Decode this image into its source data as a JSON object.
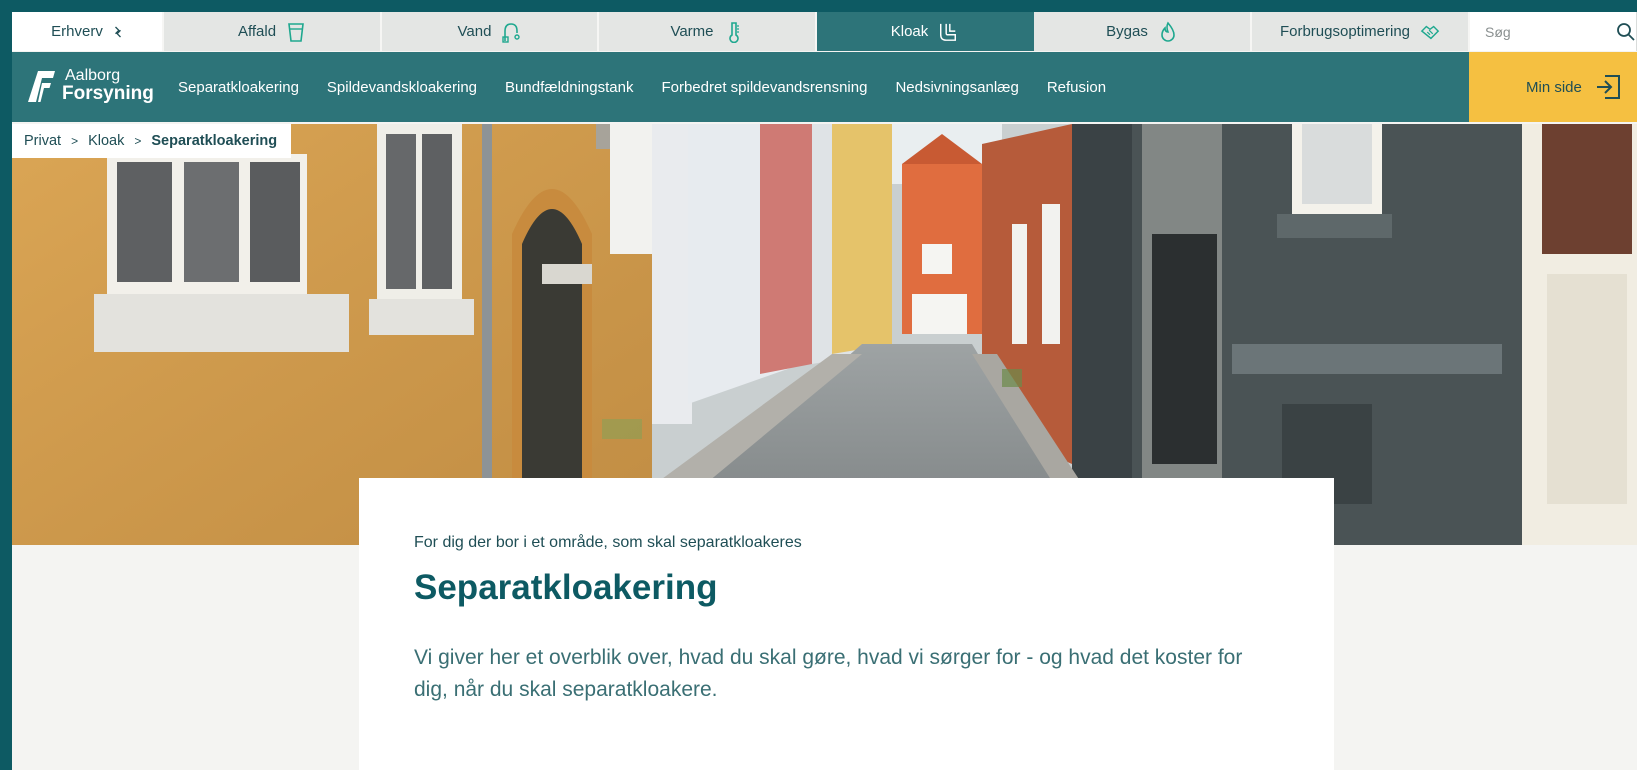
{
  "utility_tabs": [
    {
      "label": "Erhverv",
      "icon": "swap-arrows-icon"
    },
    {
      "label": "Affald",
      "icon": "bin-icon"
    },
    {
      "label": "Vand",
      "icon": "tap-icon"
    },
    {
      "label": "Varme",
      "icon": "thermometer-icon"
    },
    {
      "label": "Kloak",
      "icon": "pipes-icon",
      "active": true
    },
    {
      "label": "Bygas",
      "icon": "flame-icon"
    },
    {
      "label": "Forbrugsoptimering",
      "icon": "handshake-icon"
    }
  ],
  "search": {
    "placeholder": "Søg",
    "icon": "search-icon"
  },
  "logo": {
    "line1": "Aalborg",
    "line2": "Forsyning"
  },
  "nav": {
    "items": [
      "Separatkloakering",
      "Spildevandskloakering",
      "Bundfældningstank",
      "Forbedret spildevandsrensning",
      "Nedsivningsanlæg",
      "Refusion"
    ],
    "min_side": "Min side"
  },
  "breadcrumb": {
    "items": [
      "Privat",
      "Kloak"
    ],
    "current": "Separatkloakering",
    "separator": ">"
  },
  "hero": {
    "description": "Street with colorful houses"
  },
  "content": {
    "kicker": "For dig der bor i et område, som skal separatkloakeres",
    "title": "Separatkloakering",
    "lead": "Vi giver her et overblik over, hvad du skal gøre, hvad vi sørger for - og hvad det koster for dig, når du skal separatkloakere."
  },
  "colors": {
    "teal_dark": "#0d5a63",
    "teal": "#2d7479",
    "accent_green": "#1fa88f",
    "yellow": "#f5c041"
  }
}
